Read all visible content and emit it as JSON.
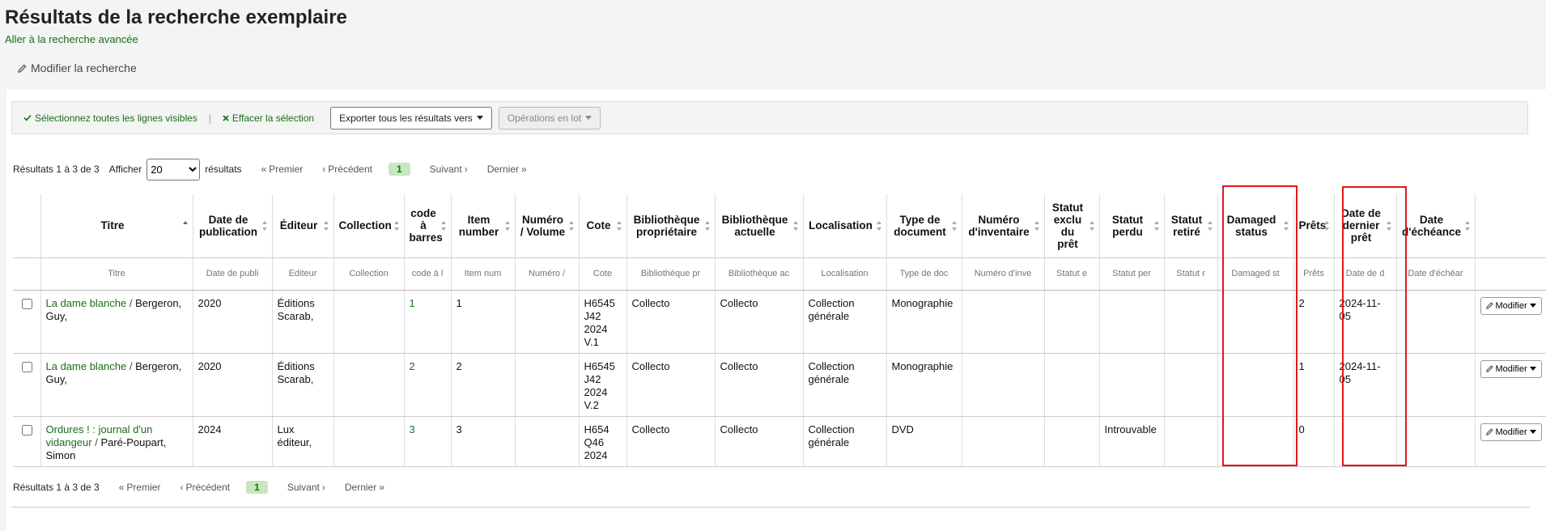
{
  "page": {
    "title": "Résultats de la recherche exemplaire",
    "advanced_link": "Aller à la recherche avancée",
    "modify_search": "Modifier la recherche"
  },
  "toolbar": {
    "select_all": "Sélectionnez toutes les lignes visibles",
    "separator": "|",
    "clear_selection": "Effacer la sélection",
    "export_label": "Exporter tous les résultats vers",
    "batch_ops": "Opérations en lot"
  },
  "pagination": {
    "results_info": "Résultats 1 à 3 de 3",
    "show_label": "Afficher",
    "per_page": "20",
    "per_page_options": [
      "20"
    ],
    "results_label": "résultats",
    "first": "Premier",
    "previous": "Précédent",
    "current": "1",
    "next": "Suivant",
    "last": "Dernier"
  },
  "table": {
    "headers": [
      "",
      "Titre",
      "Date de publication",
      "Éditeur",
      "Collection",
      "code à barres",
      "Item number",
      "Numéro / Volume",
      "Cote",
      "Bibliothèque propriétaire",
      "Bibliothèque actuelle",
      "Localisation",
      "Type de document",
      "Numéro d'inventaire",
      "Statut exclu du prêt",
      "Statut perdu",
      "Statut retiré",
      "Damaged status",
      "Prêts",
      "Date de dernier prêt",
      "Date d'échéance",
      ""
    ],
    "filters": [
      "",
      "Titre",
      "Date de publi",
      "Éditeur",
      "Collection",
      "code à l",
      "Item num",
      "Numéro /",
      "Cote",
      "Bibliothèque pr",
      "Bibliothèque ac",
      "Localisation",
      "Type de doc",
      "Numéro d'inve",
      "Statut e",
      "Statut per",
      "Statut r",
      "Damaged st",
      "Prêts",
      "Date de d",
      "Date d'échéar",
      ""
    ],
    "rows": [
      {
        "title_link": "La dame blanche /",
        "title_rest": " Bergeron, Guy,",
        "date": "2020",
        "publisher": "Éditions Scarab,",
        "collection": "",
        "barcode": "1",
        "item_number": "1",
        "volume": "",
        "callnumber": "H6545 J42 2024 V.1",
        "home_library": "Collecto",
        "current_library": "Collecto",
        "location": "Collection générale",
        "doc_type": "Monographie",
        "inventory": "",
        "notforloan": "",
        "lost": "",
        "withdrawn": "",
        "damaged": "",
        "issues": "2",
        "last_borrowed": "2024-11-05",
        "due_date": "",
        "action": "Modifier"
      },
      {
        "title_link": "La dame blanche /",
        "title_rest": " Bergeron, Guy,",
        "date": "2020",
        "publisher": "Éditions Scarab,",
        "collection": "",
        "barcode": "2",
        "item_number": "2",
        "volume": "",
        "callnumber": "H6545 J42 2024 V.2",
        "home_library": "Collecto",
        "current_library": "Collecto",
        "location": "Collection générale",
        "doc_type": "Monographie",
        "inventory": "",
        "notforloan": "",
        "lost": "",
        "withdrawn": "",
        "damaged": "",
        "issues": "1",
        "last_borrowed": "2024-11-05",
        "due_date": "",
        "action": "Modifier"
      },
      {
        "title_link": "Ordures ! : journal d'un vidangeur /",
        "title_rest": " Paré-Poupart, Simon",
        "date": "2024",
        "publisher": "Lux éditeur,",
        "collection": "",
        "barcode": "3",
        "item_number": "3",
        "volume": "",
        "callnumber": "H654 Q46 2024",
        "home_library": "Collecto",
        "current_library": "Collecto",
        "location": "Collection générale",
        "doc_type": "DVD",
        "inventory": "",
        "notforloan": "",
        "lost": "Introuvable",
        "withdrawn": "",
        "damaged": "",
        "issues": "0",
        "last_borrowed": "",
        "due_date": "",
        "action": "Modifier"
      }
    ]
  },
  "colors": {
    "link": "#1b6d16",
    "highlight": "#e01919",
    "current_page_bg": "#c8e6c0"
  }
}
